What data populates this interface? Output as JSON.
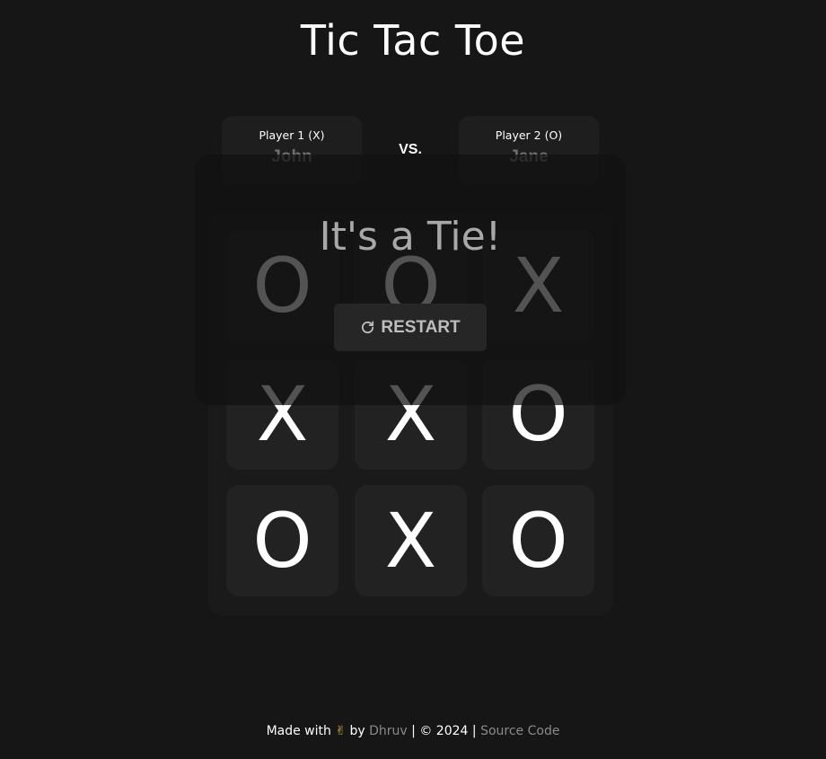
{
  "header": {
    "title": "Tic Tac Toe"
  },
  "players": {
    "player1": {
      "label": "Player 1 (X)",
      "name": "John"
    },
    "versus": "VS.",
    "player2": {
      "label": "Player 2 (O)",
      "name": "Jane"
    }
  },
  "board": {
    "cells": [
      "O",
      "O",
      "X",
      "X",
      "X",
      "O",
      "O",
      "X",
      "O"
    ]
  },
  "result_modal": {
    "message": "It's a Tie!",
    "restart_label": "RESTART",
    "restart_icon": "restart-icon"
  },
  "footer": {
    "made_with": "Made with",
    "emoji": "✌",
    "by": "by",
    "author": "Dhruv",
    "separator": "|",
    "copyright": "© 2024",
    "source_label": "Source Code"
  },
  "colors": {
    "background": "#161616",
    "card": "#1e1e1e",
    "cell": "#222222",
    "muted_text": "#6f6f6f",
    "link": "#8a8a8a"
  }
}
